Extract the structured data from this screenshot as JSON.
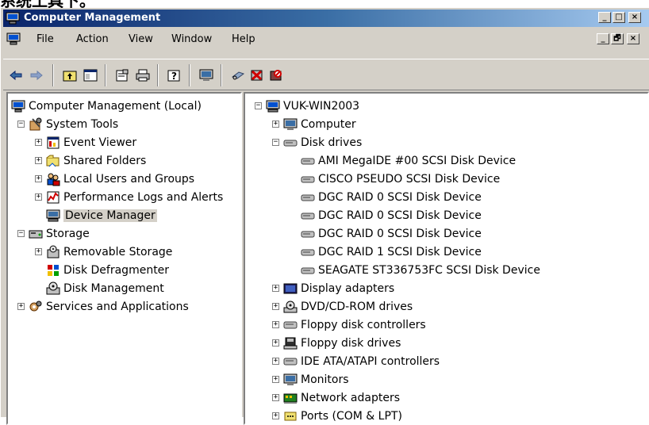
{
  "caption": "系统工具下。",
  "window": {
    "title": "Computer Management",
    "caption_buttons": {
      "minimize": "_",
      "restore": "□",
      "close": "×"
    },
    "mdi_buttons": {
      "minimize": "_",
      "restore": "🗗",
      "close": "×"
    }
  },
  "menu": {
    "file": "File",
    "action": "Action",
    "view": "View",
    "window": "Window",
    "help": "Help"
  },
  "toolbar": [
    {
      "name": "back-button",
      "icon": "arrow-left-icon"
    },
    {
      "name": "forward-button",
      "icon": "arrow-right-icon"
    },
    {
      "name": "up-one-level-button",
      "icon": "folder-up-icon"
    },
    {
      "name": "show-hide-tree-button",
      "icon": "tree-toggle-icon"
    },
    {
      "name": "properties-button",
      "icon": "properties-icon"
    },
    {
      "name": "print-button",
      "icon": "printer-icon"
    },
    {
      "name": "help-button",
      "icon": "help-icon"
    },
    {
      "name": "scan-hardware-button",
      "icon": "scan-hardware-icon"
    },
    {
      "name": "update-driver-button",
      "icon": "update-driver-icon"
    },
    {
      "name": "uninstall-button",
      "icon": "uninstall-icon"
    },
    {
      "name": "disable-button",
      "icon": "disable-icon"
    }
  ],
  "left_tree": [
    {
      "label": "Computer Management (Local)",
      "icon": "computer-management-icon",
      "level": 0,
      "expander": ""
    },
    {
      "label": "System Tools",
      "icon": "system-tools-icon",
      "level": 1,
      "expander": "−"
    },
    {
      "label": "Event Viewer",
      "icon": "event-viewer-icon",
      "level": 2,
      "expander": "+"
    },
    {
      "label": "Shared Folders",
      "icon": "shared-folders-icon",
      "level": 2,
      "expander": "+"
    },
    {
      "label": "Local Users and Groups",
      "icon": "users-groups-icon",
      "level": 2,
      "expander": "+"
    },
    {
      "label": "Performance Logs and Alerts",
      "icon": "performance-logs-icon",
      "level": 2,
      "expander": "+"
    },
    {
      "label": "Device Manager",
      "icon": "device-manager-icon",
      "level": 2,
      "expander": "",
      "selected": true
    },
    {
      "label": "Storage",
      "icon": "storage-icon",
      "level": 1,
      "expander": "−"
    },
    {
      "label": "Removable Storage",
      "icon": "removable-storage-icon",
      "level": 2,
      "expander": "+"
    },
    {
      "label": "Disk Defragmenter",
      "icon": "disk-defragmenter-icon",
      "level": 2,
      "expander": ""
    },
    {
      "label": "Disk Management",
      "icon": "disk-management-icon",
      "level": 2,
      "expander": ""
    },
    {
      "label": "Services and Applications",
      "icon": "services-applications-icon",
      "level": 1,
      "expander": "+"
    }
  ],
  "right_tree": [
    {
      "label": "VUK-WIN2003",
      "icon": "computer-icon",
      "level": 0,
      "expander": "−"
    },
    {
      "label": "Computer",
      "icon": "monitor-icon",
      "level": 1,
      "expander": "+"
    },
    {
      "label": "Disk drives",
      "icon": "disk-drive-icon",
      "level": 1,
      "expander": "−"
    },
    {
      "label": "AMI MegaIDE #00 SCSI Disk Device",
      "icon": "disk-drive-icon",
      "level": 2,
      "expander": ""
    },
    {
      "label": "CISCO PSEUDO SCSI Disk Device",
      "icon": "disk-drive-icon",
      "level": 2,
      "expander": ""
    },
    {
      "label": "DGC RAID 0 SCSI Disk Device",
      "icon": "disk-drive-icon",
      "level": 2,
      "expander": ""
    },
    {
      "label": "DGC RAID 0 SCSI Disk Device",
      "icon": "disk-drive-icon",
      "level": 2,
      "expander": ""
    },
    {
      "label": "DGC RAID 0 SCSI Disk Device",
      "icon": "disk-drive-icon",
      "level": 2,
      "expander": ""
    },
    {
      "label": "DGC RAID 1 SCSI Disk Device",
      "icon": "disk-drive-icon",
      "level": 2,
      "expander": ""
    },
    {
      "label": "SEAGATE ST336753FC SCSI Disk Device",
      "icon": "disk-drive-icon",
      "level": 2,
      "expander": ""
    },
    {
      "label": "Display adapters",
      "icon": "display-adapter-icon",
      "level": 1,
      "expander": "+"
    },
    {
      "label": "DVD/CD-ROM drives",
      "icon": "cdrom-icon",
      "level": 1,
      "expander": "+"
    },
    {
      "label": "Floppy disk controllers",
      "icon": "floppy-controller-icon",
      "level": 1,
      "expander": "+"
    },
    {
      "label": "Floppy disk drives",
      "icon": "floppy-drive-icon",
      "level": 1,
      "expander": "+"
    },
    {
      "label": "IDE ATA/ATAPI controllers",
      "icon": "ide-controller-icon",
      "level": 1,
      "expander": "+"
    },
    {
      "label": "Monitors",
      "icon": "monitor-icon",
      "level": 1,
      "expander": "+"
    },
    {
      "label": "Network adapters",
      "icon": "network-adapter-icon",
      "level": 1,
      "expander": "+"
    },
    {
      "label": "Ports (COM & LPT)",
      "icon": "port-icon",
      "level": 1,
      "expander": "+"
    }
  ],
  "colors": {
    "title_start": "#0a246a",
    "title_end": "#a6caf0",
    "face": "#d4d0c8",
    "selection": "#d4d0c8"
  }
}
